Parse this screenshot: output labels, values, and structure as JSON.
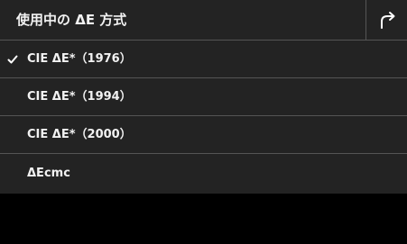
{
  "header": {
    "title": "使用中の ΔE 方式",
    "back_icon": "return-arrow-icon"
  },
  "menu": {
    "selected_index": 0,
    "items": [
      {
        "label": "CIE ΔE*（1976）",
        "selected": true
      },
      {
        "label": "CIE ΔE*（1994）",
        "selected": false
      },
      {
        "label": "CIE ΔE*（2000）",
        "selected": false
      },
      {
        "label": "ΔEcmc",
        "selected": false
      }
    ]
  },
  "colors": {
    "background": "#000000",
    "panel": "#232323",
    "divider": "#555555",
    "text": "#f2f2f2"
  }
}
